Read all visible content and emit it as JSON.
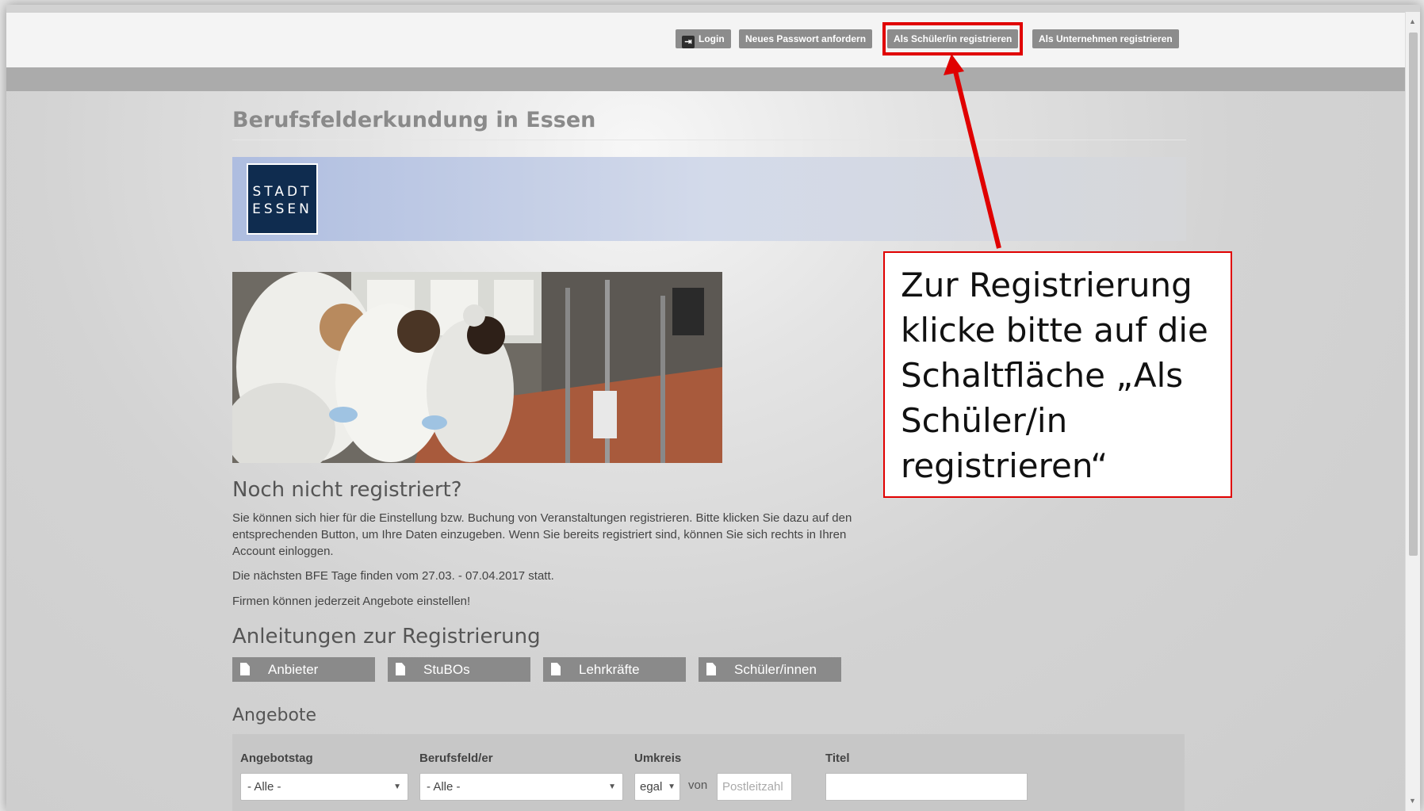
{
  "topnav": {
    "login": "Login",
    "reset_password": "Neues Passwort anfordern",
    "register_student": "Als Schüler/in registrieren",
    "register_company": "Als Unternehmen registrieren"
  },
  "page": {
    "title": "Berufsfelderkundung in Essen",
    "logo_line1": "STADT",
    "logo_line2": "ESSEN"
  },
  "intro": {
    "heading": "Noch nicht registriert?",
    "para1": "Sie können sich hier für die Einstellung bzw. Buchung von Veranstaltungen registrieren. Bitte klicken Sie dazu auf den entsprechenden Button, um Ihre Daten einzugeben. Wenn Sie bereits registriert sind, können Sie sich rechts in Ihren Account einloggen.",
    "para2": "Die nächsten BFE Tage finden vom 27.03. - 07.04.2017 statt.",
    "para3": "Firmen können jederzeit Angebote einstellen!"
  },
  "guides": {
    "heading": "Anleitungen zur Registrierung",
    "items": [
      "Anbieter",
      "StuBOs",
      "Lehrkräfte",
      "Schüler/innen"
    ]
  },
  "offers": {
    "heading": "Angebote",
    "label_day": "Angebotstag",
    "label_field": "Berufsfeld/er",
    "label_radius": "Umkreis",
    "label_title": "Titel",
    "day_value": "- Alle -",
    "field_value": "- Alle -",
    "radius_value": "egal",
    "von": "von",
    "postcode_placeholder": "Postleitzahl"
  },
  "callout": {
    "text": "Zur Registrierung klicke bitte auf die Schaltfläche „Als Schüler/in registrieren“"
  },
  "colors": {
    "highlight": "#e00000",
    "button_gray": "#8c8c8c",
    "logo_navy": "#0f2c4f"
  }
}
